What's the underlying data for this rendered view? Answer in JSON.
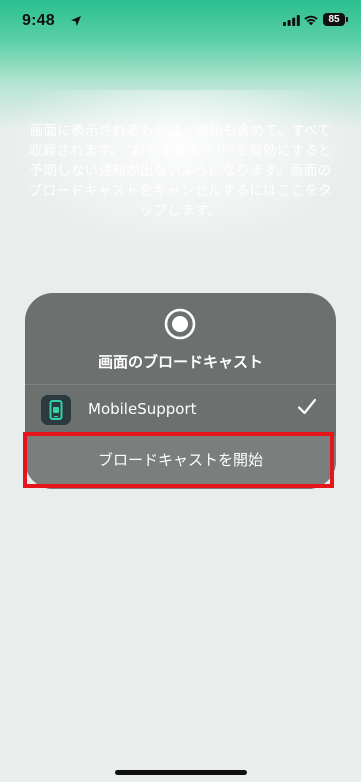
{
  "status_bar": {
    "time": "9:48",
    "battery": "85"
  },
  "info_text": "画面に表示されるものは、通知も含めて、すべて収録されます。“おやすみモード”を有効にすると予期しない通知が出ないようになります。画面のブロードキャストをキャンセルするにはここをタップします。",
  "panel": {
    "title": "画面のブロードキャスト",
    "app_name": "MobileSupport",
    "start_label": "ブロードキャストを開始"
  },
  "colors": {
    "header_green": "#2bbf8f",
    "panel_bg": "#6c706f",
    "highlight_red": "#e8141c"
  }
}
